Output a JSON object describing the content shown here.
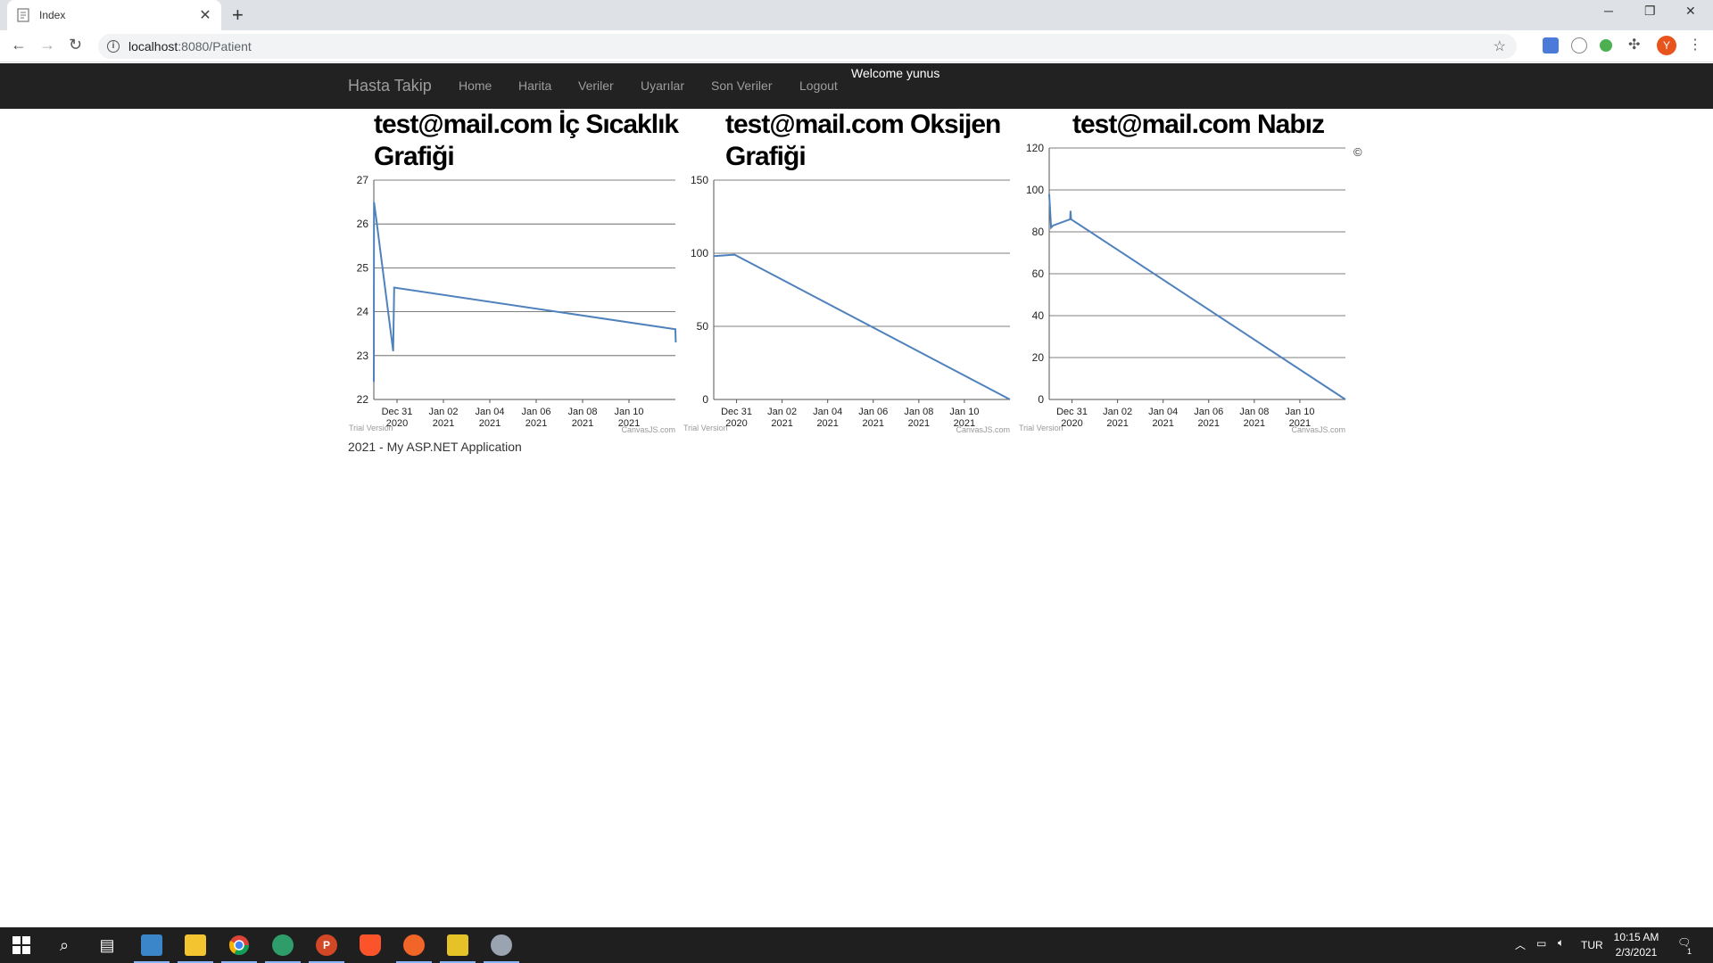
{
  "browser": {
    "tab_title": "Index",
    "url_host": "localhost",
    "url_rest": ":8080/Patient",
    "profile_initial": "Y"
  },
  "navbar": {
    "brand": "Hasta Takip",
    "links": [
      "Home",
      "Harita",
      "Veriler",
      "Uyarılar",
      "Son Veriler",
      "Logout"
    ],
    "welcome": "Welcome yunus"
  },
  "charts": [
    {
      "title": "test@mail.com İç Sıcaklık Grafiği",
      "title_lines": [
        "test@mail.com İç Sıcaklık",
        "Grafiği"
      ],
      "trial": "Trial Version",
      "credit": "CanvasJS.com"
    },
    {
      "title": "test@mail.com Oksijen Grafiği",
      "title_lines": [
        "test@mail.com Oksijen",
        "Grafiği"
      ],
      "trial": "Trial Version",
      "credit": "CanvasJS.com"
    },
    {
      "title": "test@mail.com Nabız",
      "title_lines": [
        "test@mail.com Nabız"
      ],
      "trial": "Trial Version",
      "credit": "CanvasJS.com"
    }
  ],
  "chart_data": [
    {
      "type": "line",
      "title": "test@mail.com İç Sıcaklık Grafiği",
      "x_ticks": [
        [
          "Dec 31",
          "2020"
        ],
        [
          "Jan 02",
          "2021"
        ],
        [
          "Jan 04",
          "2021"
        ],
        [
          "Jan 06",
          "2021"
        ],
        [
          "Jan 08",
          "2021"
        ],
        [
          "Jan 10",
          "2021"
        ]
      ],
      "y_ticks": [
        22,
        23,
        24,
        25,
        26,
        27
      ],
      "ylim": [
        22,
        27
      ],
      "xlim": [
        "2020-12-30",
        "2021-01-12"
      ],
      "points": [
        [
          "2020-12-30T00:00",
          22.4
        ],
        [
          "2020-12-30T00:10",
          26.5
        ],
        [
          "2020-12-30T02:00",
          26.2
        ],
        [
          "2020-12-30T20:00",
          23.1
        ],
        [
          "2020-12-30T21:00",
          24.55
        ],
        [
          "2021-01-12T00:00",
          23.6
        ],
        [
          "2021-01-12T00:20",
          23.3
        ]
      ],
      "color": "#4f81bc",
      "grid": true
    },
    {
      "type": "line",
      "title": "test@mail.com Oksijen Grafiği",
      "x_ticks": [
        [
          "Dec 31",
          "2020"
        ],
        [
          "Jan 02",
          "2021"
        ],
        [
          "Jan 04",
          "2021"
        ],
        [
          "Jan 06",
          "2021"
        ],
        [
          "Jan 08",
          "2021"
        ],
        [
          "Jan 10",
          "2021"
        ]
      ],
      "y_ticks": [
        0,
        50,
        100,
        150
      ],
      "ylim": [
        0,
        150
      ],
      "xlim": [
        "2020-12-30",
        "2021-01-12"
      ],
      "points": [
        [
          "2020-12-30T00:00",
          98
        ],
        [
          "2020-12-30T22:00",
          99
        ],
        [
          "2021-01-12T00:00",
          0
        ]
      ],
      "color": "#4f81bc",
      "grid": true
    },
    {
      "type": "line",
      "title": "test@mail.com Nabız",
      "x_ticks": [
        [
          "Dec 31",
          "2020"
        ],
        [
          "Jan 02",
          "2021"
        ],
        [
          "Jan 04",
          "2021"
        ],
        [
          "Jan 06",
          "2021"
        ],
        [
          "Jan 08",
          "2021"
        ],
        [
          "Jan 10",
          "2021"
        ]
      ],
      "y_ticks": [
        0,
        20,
        40,
        60,
        80,
        100,
        120
      ],
      "ylim": [
        0,
        120
      ],
      "xlim": [
        "2020-12-30",
        "2021-01-12"
      ],
      "points": [
        [
          "2020-12-30T00:00",
          98
        ],
        [
          "2020-12-30T02:00",
          82
        ],
        [
          "2020-12-30T04:00",
          83
        ],
        [
          "2020-12-30T22:00",
          86
        ],
        [
          "2020-12-30T22:30",
          90
        ],
        [
          "2020-12-30T23:00",
          86
        ],
        [
          "2021-01-12T00:00",
          0
        ]
      ],
      "color": "#4f81bc",
      "grid": true
    }
  ],
  "footer": {
    "text": "2021 - My ASP.NET Application",
    "copyright": "©"
  },
  "taskbar": {
    "lang": "TUR",
    "time": "10:15 AM",
    "date": "2/3/2021",
    "notif_count": "1"
  },
  "colors": {
    "navbar_bg": "#222222",
    "line": "#4f81bc"
  }
}
